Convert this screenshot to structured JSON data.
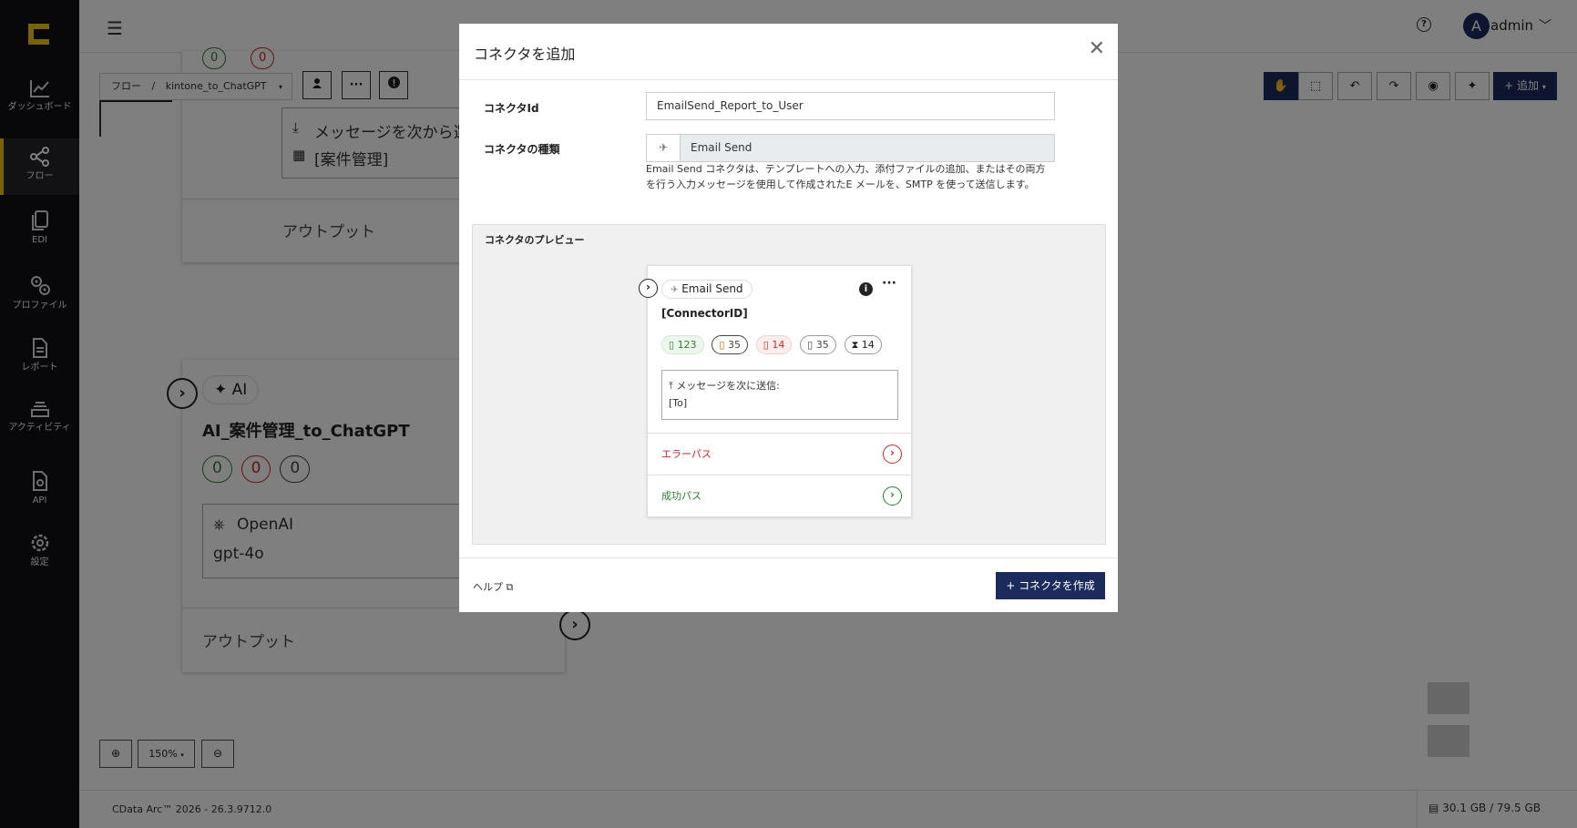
{
  "sidebar": {
    "items": [
      {
        "label": "ダッシュボード",
        "icon": "chart-line-icon"
      },
      {
        "label": "フロー",
        "icon": "share-nodes-icon",
        "active": true
      },
      {
        "label": "EDI",
        "icon": "documents-icon"
      },
      {
        "label": "プロファイル",
        "icon": "gears-icon"
      },
      {
        "label": "レポート",
        "icon": "report-icon"
      },
      {
        "label": "アクティビティ",
        "icon": "stack-icon"
      },
      {
        "label": "API",
        "icon": "api-file-icon"
      },
      {
        "label": "設定",
        "icon": "settings-gear-icon"
      }
    ]
  },
  "topbar": {
    "user_initial": "A",
    "user_name": "admin"
  },
  "breadcrumb": {
    "root": "フロー",
    "separator": "/",
    "current": "kintone_to_ChatGPT"
  },
  "toolbar": {
    "add_label": "追加"
  },
  "canvas": {
    "top_node": {
      "badge_ok": "0",
      "badge_err": "0",
      "message_label": "メッセージを次から選択:",
      "message_value": "[案件管理]",
      "output_label": "アウトプット"
    },
    "ai_node": {
      "type_label": "AI",
      "title": "AI_案件管理_to_ChatGPT",
      "badge_ok": "0",
      "badge_err": "0",
      "badge_doc": "0",
      "provider": "OpenAI",
      "model": "gpt-4o",
      "output_label": "アウトプット"
    },
    "zoom": "150%"
  },
  "footer": {
    "version": "CData Arc™ 2026 - 26.3.9712.0",
    "storage": "30.1 GB / 79.5 GB"
  },
  "modal": {
    "title": "コネクタを追加",
    "connector_id_label": "コネクタId",
    "connector_id_value": "EmailSend_Report_to_User",
    "connector_type_label": "コネクタの種類",
    "connector_type_value": "Email Send",
    "description": "Email Send コネクタは、テンプレートへの入力、添付ファイルの追加、またはその両方を行う入力メッセージを使用して作成されたE メールを、SMTP を使って送信します。",
    "preview_title": "コネクタのプレビュー",
    "preview": {
      "type": "Email Send",
      "connector_id": "[ConnectorID]",
      "badges": [
        {
          "value": "123",
          "color": "#2e7d32"
        },
        {
          "value": "35",
          "color": "#b26a00"
        },
        {
          "value": "14",
          "color": "#c62828"
        },
        {
          "value": "35",
          "color": "#444444"
        },
        {
          "value": "14",
          "color": "#222222"
        }
      ],
      "message_label": "メッセージを次に送信:",
      "message_value": "[To]",
      "error_path": "エラーパス",
      "success_path": "成功パス"
    },
    "help_label": "ヘルプ",
    "create_label": "コネクタを作成"
  },
  "colors": {
    "primary": "#1b2c5c",
    "success": "#2e7d32",
    "error": "#c62828",
    "warning": "#b26a00",
    "sidebar_bg": "#101014",
    "accent": "#f0c419"
  }
}
